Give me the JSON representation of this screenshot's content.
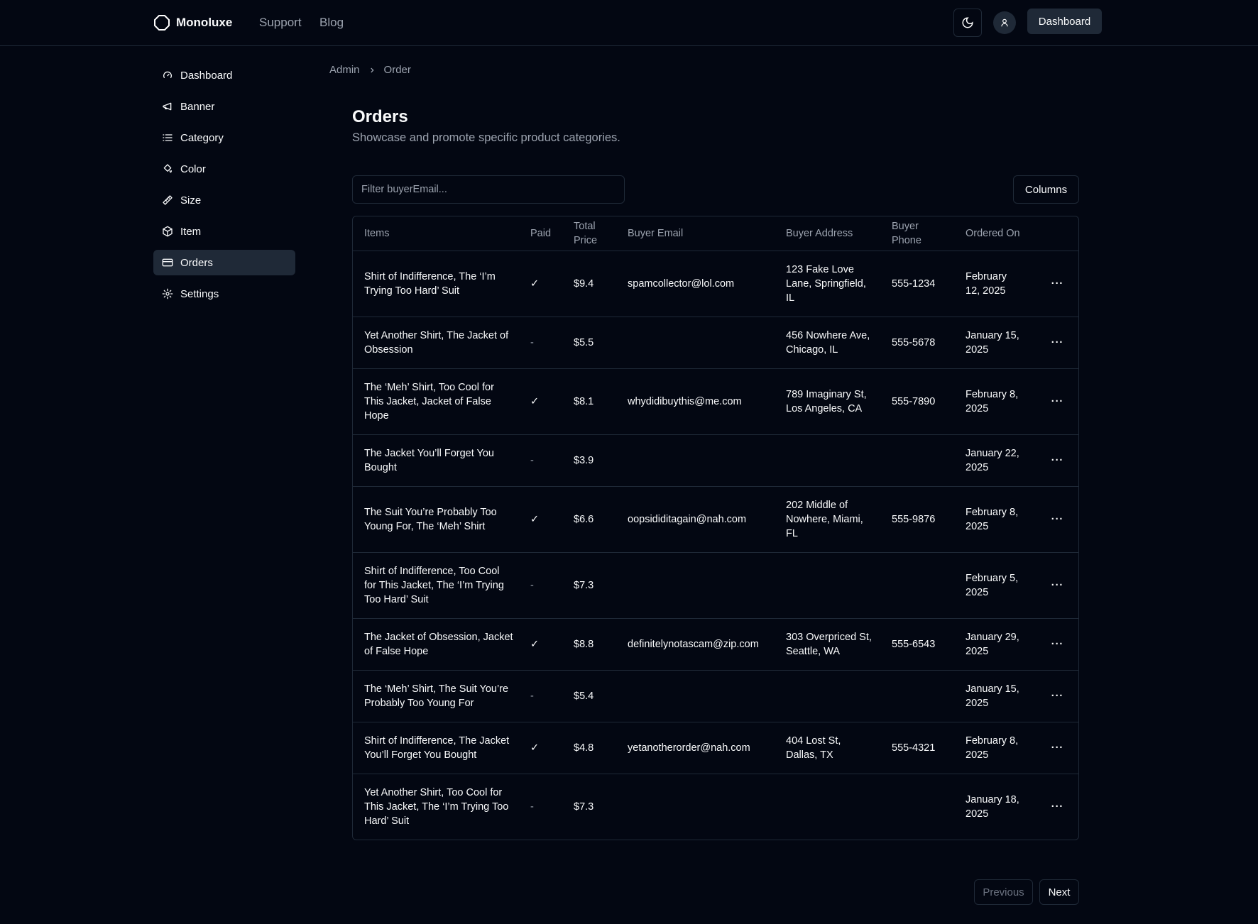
{
  "header": {
    "brand": "Monoluxe",
    "links": [
      "Support",
      "Blog"
    ],
    "dashboard_label": "Dashboard"
  },
  "sidebar": {
    "items": [
      {
        "label": "Dashboard",
        "icon": "gauge-icon"
      },
      {
        "label": "Banner",
        "icon": "megaphone-icon"
      },
      {
        "label": "Category",
        "icon": "list-icon"
      },
      {
        "label": "Color",
        "icon": "paint-bucket-icon"
      },
      {
        "label": "Size",
        "icon": "ruler-icon"
      },
      {
        "label": "Item",
        "icon": "package-icon"
      },
      {
        "label": "Orders",
        "icon": "credit-card-icon",
        "active": true
      },
      {
        "label": "Settings",
        "icon": "gear-icon"
      }
    ]
  },
  "breadcrumb": [
    "Admin",
    "Order"
  ],
  "page": {
    "title": "Orders",
    "subtitle": "Showcase and promote specific product categories."
  },
  "filter": {
    "placeholder": "Filter buyerEmail...",
    "value": ""
  },
  "columns_label": "Columns",
  "table": {
    "headers": [
      "Items",
      "Paid",
      "Total Price",
      "Buyer Email",
      "Buyer Address",
      "Buyer Phone",
      "Ordered On"
    ],
    "rows": [
      {
        "items": "Shirt of Indifference, The ‘I’m Trying Too Hard’ Suit",
        "paid": "✓",
        "price": "$9.4",
        "email": "spamcollector@lol.com",
        "address": "123 Fake Love Lane, Springfield, IL",
        "phone": "555-1234",
        "date": "February 12, 2025"
      },
      {
        "items": "Yet Another Shirt, The Jacket of Obsession",
        "paid": "-",
        "price": "$5.5",
        "email": "",
        "address": "456 Nowhere Ave, Chicago, IL",
        "phone": "555-5678",
        "date": "January 15, 2025"
      },
      {
        "items": "The ‘Meh’ Shirt, Too Cool for This Jacket, Jacket of False Hope",
        "paid": "✓",
        "price": "$8.1",
        "email": "whydidibuythis@me.com",
        "address": "789 Imaginary St, Los Angeles, CA",
        "phone": "555-7890",
        "date": "February 8, 2025"
      },
      {
        "items": "The Jacket You’ll Forget You Bought",
        "paid": "-",
        "price": "$3.9",
        "email": "",
        "address": "",
        "phone": "",
        "date": "January 22, 2025"
      },
      {
        "items": "The Suit You’re Probably Too Young For, The ‘Meh’ Shirt",
        "paid": "✓",
        "price": "$6.6",
        "email": "oopsididitagain@nah.com",
        "address": "202 Middle of Nowhere, Miami, FL",
        "phone": "555-9876",
        "date": "February 8, 2025"
      },
      {
        "items": "Shirt of Indifference, Too Cool for This Jacket, The ‘I’m Trying Too Hard’ Suit",
        "paid": "-",
        "price": "$7.3",
        "email": "",
        "address": "",
        "phone": "",
        "date": "February 5, 2025"
      },
      {
        "items": "The Jacket of Obsession, Jacket of False Hope",
        "paid": "✓",
        "price": "$8.8",
        "email": "definitelynotascam@zip.com",
        "address": "303 Overpriced St, Seattle, WA",
        "phone": "555-6543",
        "date": "January 29, 2025"
      },
      {
        "items": "The ‘Meh’ Shirt, The Suit You’re Probably Too Young For",
        "paid": "-",
        "price": "$5.4",
        "email": "",
        "address": "",
        "phone": "",
        "date": "January 15, 2025"
      },
      {
        "items": "Shirt of Indifference, The Jacket You’ll Forget You Bought",
        "paid": "✓",
        "price": "$4.8",
        "email": "yetanotherorder@nah.com",
        "address": "404 Lost St, Dallas, TX",
        "phone": "555-4321",
        "date": "February 8, 2025"
      },
      {
        "items": "Yet Another Shirt, Too Cool for This Jacket, The ‘I’m Trying Too Hard’ Suit",
        "paid": "-",
        "price": "$7.3",
        "email": "",
        "address": "",
        "phone": "",
        "date": "January 18, 2025"
      }
    ]
  },
  "pagination": {
    "previous": "Previous",
    "next": "Next",
    "previous_disabled": true
  }
}
